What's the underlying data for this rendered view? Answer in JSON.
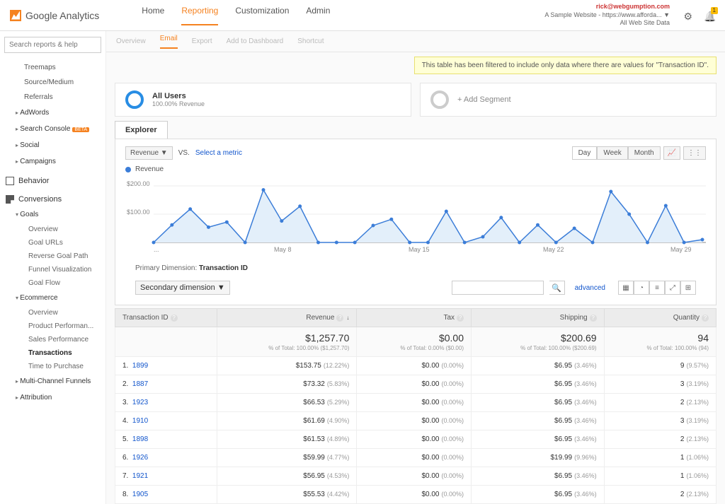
{
  "header": {
    "logo_text": "Google Analytics",
    "nav": [
      "Home",
      "Reporting",
      "Customization",
      "Admin"
    ],
    "active_nav": "Reporting",
    "email": "rick@webgumption.com",
    "site": "A Sample Website - https://www.afforda...",
    "dataset": "All Web Site Data",
    "bell_count": "1"
  },
  "search_placeholder": "Search reports & help",
  "sidebar": {
    "top_subs": [
      "Treemaps",
      "Source/Medium",
      "Referrals"
    ],
    "groups1": [
      "AdWords",
      "Search Console",
      "Social",
      "Campaigns"
    ],
    "behavior_label": "Behavior",
    "conversions_label": "Conversions",
    "goals_label": "Goals",
    "goals_items": [
      "Overview",
      "Goal URLs",
      "Reverse Goal Path",
      "Funnel Visualization",
      "Goal Flow"
    ],
    "ecom_label": "Ecommerce",
    "ecom_items": [
      "Overview",
      "Product Performan...",
      "Sales Performance",
      "Transactions",
      "Time to Purchase"
    ],
    "ecom_active": "Transactions",
    "bottom": [
      "Multi-Channel Funnels",
      "Attribution"
    ],
    "beta_tag": "BETA"
  },
  "subhead_items": [
    "Overview",
    "Email",
    "Export",
    "Add to Dashboard",
    "Shortcut"
  ],
  "banner": "This table has been filtered to include only data where there are values for \"Transaction ID\".",
  "segment_panel": {
    "title": "All Users",
    "sub": "100.00% Revenue",
    "add": "+ Add Segment"
  },
  "explorer_tab": "Explorer",
  "metric_selector": "Revenue",
  "vs": "VS.",
  "select_metric": "Select a metric",
  "gran": {
    "day": "Day",
    "week": "Week",
    "month": "Month"
  },
  "legend_label": "Revenue",
  "primary_dimension_label": "Primary Dimension:",
  "primary_dimension_value": "Transaction ID",
  "secondary_dim": "Secondary dimension",
  "advanced_link": "advanced",
  "columns": {
    "c1": "Transaction ID",
    "c2": "Revenue",
    "c3": "Tax",
    "c4": "Shipping",
    "c5": "Quantity"
  },
  "summary": {
    "revenue": "$1,257.70",
    "revenue_sub": "% of Total: 100.00% ($1,257.70)",
    "tax": "$0.00",
    "tax_sub": "% of Total: 0.00% ($0.00)",
    "shipping": "$200.69",
    "shipping_sub": "% of Total: 100.00% ($200.69)",
    "qty": "94",
    "qty_sub": "% of Total: 100.00% (94)"
  },
  "rows": [
    {
      "n": "1.",
      "id": "1899",
      "rev": "$153.75",
      "revp": "(12.22%)",
      "tax": "$0.00",
      "taxp": "(0.00%)",
      "ship": "$6.95",
      "shipp": "(3.46%)",
      "qty": "9",
      "qtyp": "(9.57%)"
    },
    {
      "n": "2.",
      "id": "1887",
      "rev": "$73.32",
      "revp": "(5.83%)",
      "tax": "$0.00",
      "taxp": "(0.00%)",
      "ship": "$6.95",
      "shipp": "(3.46%)",
      "qty": "3",
      "qtyp": "(3.19%)"
    },
    {
      "n": "3.",
      "id": "1923",
      "rev": "$66.53",
      "revp": "(5.29%)",
      "tax": "$0.00",
      "taxp": "(0.00%)",
      "ship": "$6.95",
      "shipp": "(3.46%)",
      "qty": "2",
      "qtyp": "(2.13%)"
    },
    {
      "n": "4.",
      "id": "1910",
      "rev": "$61.69",
      "revp": "(4.90%)",
      "tax": "$0.00",
      "taxp": "(0.00%)",
      "ship": "$6.95",
      "shipp": "(3.46%)",
      "qty": "3",
      "qtyp": "(3.19%)"
    },
    {
      "n": "5.",
      "id": "1898",
      "rev": "$61.53",
      "revp": "(4.89%)",
      "tax": "$0.00",
      "taxp": "(0.00%)",
      "ship": "$6.95",
      "shipp": "(3.46%)",
      "qty": "2",
      "qtyp": "(2.13%)"
    },
    {
      "n": "6.",
      "id": "1926",
      "rev": "$59.99",
      "revp": "(4.77%)",
      "tax": "$0.00",
      "taxp": "(0.00%)",
      "ship": "$19.99",
      "shipp": "(9.96%)",
      "qty": "1",
      "qtyp": "(1.06%)"
    },
    {
      "n": "7.",
      "id": "1921",
      "rev": "$56.95",
      "revp": "(4.53%)",
      "tax": "$0.00",
      "taxp": "(0.00%)",
      "ship": "$6.95",
      "shipp": "(3.46%)",
      "qty": "1",
      "qtyp": "(1.06%)"
    },
    {
      "n": "8.",
      "id": "1905",
      "rev": "$55.53",
      "revp": "(4.42%)",
      "tax": "$0.00",
      "taxp": "(0.00%)",
      "ship": "$6.95",
      "shipp": "(3.46%)",
      "qty": "2",
      "qtyp": "(2.13%)"
    }
  ],
  "chart_data": {
    "type": "line",
    "title": "Revenue",
    "ylabel": "",
    "xlabel": "",
    "ylim": [
      0,
      200
    ],
    "y_ticks": [
      "$200.00",
      "$100.00"
    ],
    "x_ticks": [
      "...",
      "May 8",
      "May 15",
      "May 22",
      "May 29"
    ],
    "x": [
      0,
      1,
      2,
      3,
      4,
      5,
      6,
      7,
      8,
      9,
      10,
      11,
      12,
      13,
      14,
      15,
      16,
      17,
      18,
      19,
      20,
      21,
      22,
      23,
      24,
      25,
      26,
      27,
      28,
      29,
      30
    ],
    "values": [
      0,
      62,
      118,
      54,
      72,
      0,
      186,
      76,
      128,
      0,
      0,
      0,
      60,
      82,
      0,
      0,
      110,
      0,
      20,
      88,
      0,
      62,
      0,
      50,
      0,
      180,
      100,
      0,
      130,
      0,
      10
    ]
  }
}
